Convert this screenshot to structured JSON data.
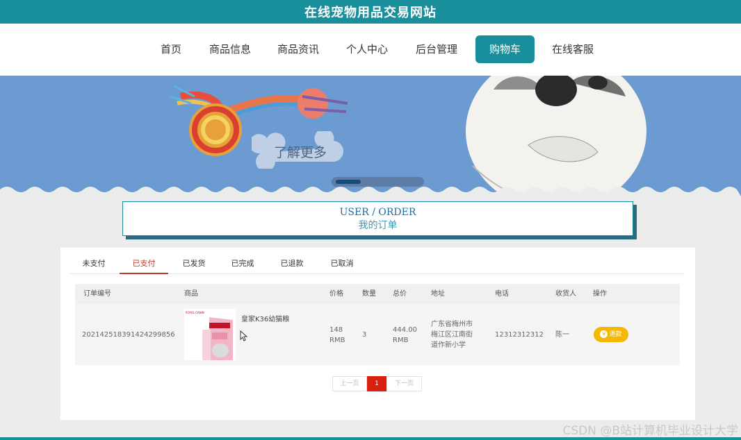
{
  "site": {
    "title": "在线宠物用品交易网站"
  },
  "nav": {
    "items": [
      "首页",
      "商品信息",
      "商品资讯",
      "个人中心",
      "后台管理",
      "购物车",
      "在线客服"
    ],
    "active": "购物车",
    "accent": "#1a8f9c"
  },
  "banner": {
    "button_label": "了解更多"
  },
  "order_header": {
    "title_en": "USER / ORDER",
    "title_cn": "我的订单"
  },
  "tabs": {
    "items": [
      "未支付",
      "已支付",
      "已发货",
      "已完成",
      "已退款",
      "已取消"
    ],
    "active": "已支付",
    "active_color": "#c23a2a"
  },
  "table": {
    "columns": [
      "订单编号",
      "商品",
      "价格",
      "数量",
      "总价",
      "地址",
      "电话",
      "收货人",
      "操作"
    ],
    "rows": [
      {
        "order_no": "20214251839142429985 6",
        "order_no_display": "202142518391424299856",
        "product_name": "皇家K36幼猫粮",
        "price_line1": "148",
        "price_line2": "RMB",
        "qty": "3",
        "total_line1": "444.00",
        "total_line2": "RMB",
        "address_line1": "广东省梅州市",
        "address_line2": "梅江区江南街",
        "address_line3": "道作新小学",
        "phone": "12312312312",
        "receiver": "陈一",
        "action_label": "退款",
        "action_icon": "yen-icon"
      }
    ]
  },
  "pagination": {
    "prev": "上一页",
    "current": "1",
    "next": "下一页"
  },
  "watermark": "CSDN @B站计算机毕业设计大学"
}
